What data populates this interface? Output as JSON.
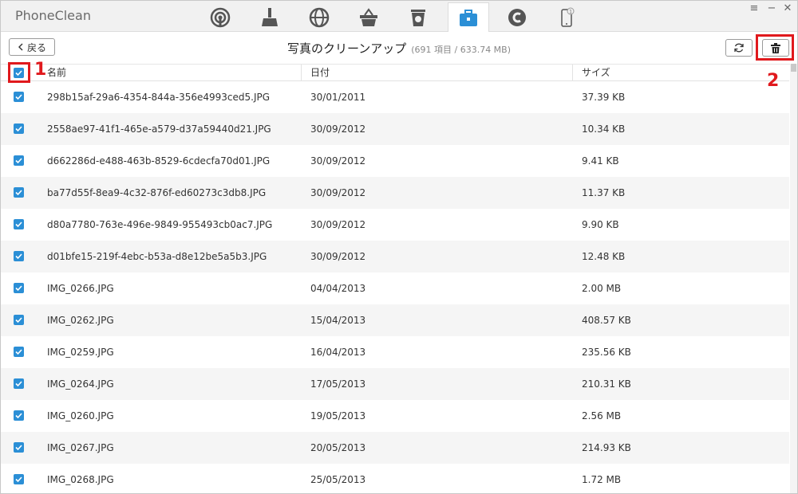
{
  "app": {
    "title": "PhoneClean"
  },
  "tabs": [
    {
      "icon": "signal-icon",
      "active": false
    },
    {
      "icon": "broom-icon",
      "active": false
    },
    {
      "icon": "globe-icon",
      "active": false
    },
    {
      "icon": "basket-icon",
      "active": false
    },
    {
      "icon": "trash-bin-icon",
      "active": false
    },
    {
      "icon": "toolbox-icon",
      "active": true
    },
    {
      "icon": "c-circle-icon",
      "active": false
    },
    {
      "icon": "phone-icon",
      "active": false,
      "badge": "1"
    }
  ],
  "toolbar": {
    "back_label": "戻る",
    "page_title": "写真のクリーンアップ",
    "count_text": "(691 項目 / 633.74 MB)"
  },
  "annotations": {
    "step1": "1",
    "step2": "2"
  },
  "table": {
    "headers": [
      "名前",
      "日付",
      "サイズ"
    ],
    "rows": [
      {
        "name": "298b15af-29a6-4354-844a-356e4993ced5.JPG",
        "date": "30/01/2011",
        "size": "37.39 KB",
        "checked": true
      },
      {
        "name": "2558ae97-41f1-465e-a579-d37a59440d21.JPG",
        "date": "30/09/2012",
        "size": "10.34 KB",
        "checked": true
      },
      {
        "name": "d662286d-e488-463b-8529-6cdecfa70d01.JPG",
        "date": "30/09/2012",
        "size": "9.41 KB",
        "checked": true
      },
      {
        "name": "ba77d55f-8ea9-4c32-876f-ed60273c3db8.JPG",
        "date": "30/09/2012",
        "size": "11.37 KB",
        "checked": true
      },
      {
        "name": "d80a7780-763e-496e-9849-955493cb0ac7.JPG",
        "date": "30/09/2012",
        "size": "9.90 KB",
        "checked": true
      },
      {
        "name": "d01bfe15-219f-4ebc-b53a-d8e12be5a5b3.JPG",
        "date": "30/09/2012",
        "size": "12.48 KB",
        "checked": true
      },
      {
        "name": "IMG_0266.JPG",
        "date": "04/04/2013",
        "size": "2.00 MB",
        "checked": true
      },
      {
        "name": "IMG_0262.JPG",
        "date": "15/04/2013",
        "size": "408.57 KB",
        "checked": true
      },
      {
        "name": "IMG_0259.JPG",
        "date": "16/04/2013",
        "size": "235.56 KB",
        "checked": true
      },
      {
        "name": "IMG_0264.JPG",
        "date": "17/05/2013",
        "size": "210.31 KB",
        "checked": true
      },
      {
        "name": "IMG_0260.JPG",
        "date": "19/05/2013",
        "size": "2.56 MB",
        "checked": true
      },
      {
        "name": "IMG_0267.JPG",
        "date": "20/05/2013",
        "size": "214.93 KB",
        "checked": true
      },
      {
        "name": "IMG_0268.JPG",
        "date": "25/05/2013",
        "size": "1.72 MB",
        "checked": true
      }
    ]
  },
  "colors": {
    "accent": "#2b8fd6",
    "highlight": "#e0191d"
  }
}
